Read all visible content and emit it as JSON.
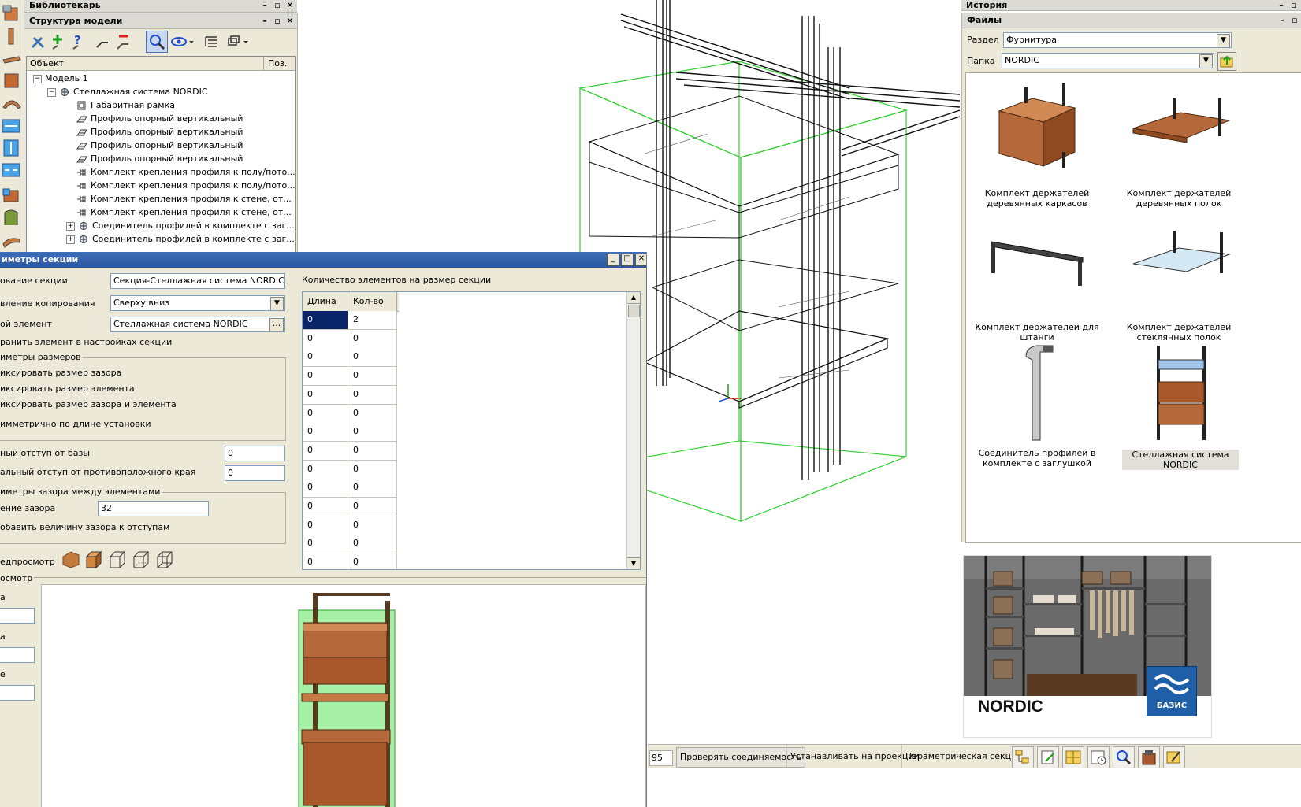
{
  "librarian_panel": {
    "title": "Библиотекарь",
    "controls": [
      "–",
      "▫",
      "✕"
    ]
  },
  "model_structure": {
    "title": "Структура модели",
    "controls": [
      "–",
      "▫",
      "✕"
    ],
    "columns": {
      "object": "Объект",
      "pos": "Поз."
    },
    "tree": [
      {
        "label": "Модель 1",
        "level": 0,
        "expander": "−",
        "icon": "none"
      },
      {
        "label": "Стеллажная система NORDIC",
        "level": 1,
        "expander": "−",
        "icon": "assembly"
      },
      {
        "label": "Габаритная рамка",
        "level": 2,
        "expander": "",
        "icon": "frame"
      },
      {
        "label": "Профиль опорный вертикальный",
        "level": 2,
        "expander": "",
        "icon": "profile"
      },
      {
        "label": "Профиль опорный вертикальный",
        "level": 2,
        "expander": "",
        "icon": "profile"
      },
      {
        "label": "Профиль опорный вертикальный",
        "level": 2,
        "expander": "",
        "icon": "profile"
      },
      {
        "label": "Профиль опорный вертикальный",
        "level": 2,
        "expander": "",
        "icon": "profile"
      },
      {
        "label": "Комплект крепления профиля к полу/пото...",
        "level": 2,
        "expander": "",
        "icon": "fastener"
      },
      {
        "label": "Комплект крепления профиля к полу/пото...",
        "level": 2,
        "expander": "",
        "icon": "fastener"
      },
      {
        "label": "Комплект крепления профиля к стене, от...",
        "level": 2,
        "expander": "",
        "icon": "fastener"
      },
      {
        "label": "Комплект крепления профиля к стене, от...",
        "level": 2,
        "expander": "",
        "icon": "fastener"
      },
      {
        "label": "Соединитель профилей в комплекте с заг...",
        "level": 2,
        "expander": "+",
        "icon": "assembly"
      },
      {
        "label": "Соединитель профилей в комплекте с заг...",
        "level": 2,
        "expander": "+",
        "icon": "assembly"
      }
    ]
  },
  "section_dialog": {
    "title": "иметры секции",
    "controls": [
      "_",
      "□",
      "✕"
    ],
    "name_label": "ование секции",
    "name_value": "Секция-Стеллажная система NORDIC",
    "copy_dir_label": "вление копирования",
    "copy_dir_value": "Сверху вниз",
    "element_label": "ой элемент",
    "element_value": "Стеллажная система NORDIC",
    "element_btn": "...",
    "save_label": "ранить элемент в настройках секции",
    "sizes_group": "иметры размеров",
    "fix_gap": "иксировать размер зазора",
    "fix_elem": "иксировать размер элемента",
    "fix_both": "иксировать размер зазора и элемента",
    "symmetric": "имметрично по длине установки",
    "offset_base_label": "ный отступ от базы",
    "offset_base_value": "0",
    "offset_opp_label": "альный отступ от противоположного края",
    "offset_opp_value": "0",
    "gap_group": "иметры зазора между элементами",
    "gap_label": "ение зазора",
    "gap_value": "32",
    "add_gap_label": "обавить величину зазора к отступам",
    "preview_label": "едпросмотр",
    "view_group": "осмотр",
    "side_labels": [
      "а",
      "а",
      "е"
    ],
    "count_label": "Количество элементов на размер секции",
    "table_headers": {
      "length": "Длина",
      "qty": "Кол-во"
    },
    "table_rows": [
      [
        "0",
        "2"
      ],
      [
        "0",
        "0"
      ],
      [
        "0",
        "0"
      ],
      [
        "0",
        "0"
      ],
      [
        "0",
        "0"
      ],
      [
        "0",
        "0"
      ],
      [
        "0",
        "0"
      ],
      [
        "0",
        "0"
      ],
      [
        "0",
        "0"
      ],
      [
        "0",
        "0"
      ],
      [
        "0",
        "0"
      ],
      [
        "0",
        "0"
      ],
      [
        "0",
        "0"
      ],
      [
        "0",
        "0"
      ]
    ]
  },
  "history_panel": {
    "title": "История",
    "controls": [
      "–",
      "▫"
    ]
  },
  "files_panel": {
    "title": "Файлы",
    "controls": [
      "–",
      "▫"
    ],
    "section_label": "Раздел",
    "section_value": "Фурнитура",
    "folder_label": "Папка",
    "folder_value": "NORDIC",
    "items": [
      "Комплект держателей деревянных каркасов",
      "Комплект держателей деревянных полок",
      "Комплект держателей для штанги",
      "Комплект держателей стеклянных полок",
      "Соединитель профилей в комплекте с заглушкой",
      "Стеллажная система NORDIC"
    ],
    "selected_index": 5
  },
  "preview_banner": {
    "brand": "NORDIC",
    "logo_text": "БАЗИС"
  },
  "status_bar": {
    "coord": "95",
    "items": [
      "Проверять соединяемость",
      "Устанавливать на проекции",
      "Параметрическая секция"
    ]
  },
  "colors": {
    "panel_bg": "#ece9d8",
    "title_bg": "#dcdad5",
    "selection": "#0a246a",
    "green_wire": "#2fd02f",
    "wood": "#b5683a"
  },
  "icons": [
    "tools-icon",
    "add-icon",
    "help-icon",
    "connect-icon",
    "remove-icon",
    "reconnect-icon",
    "find-icon",
    "eye-icon",
    "list-icon",
    "layers-icon"
  ]
}
